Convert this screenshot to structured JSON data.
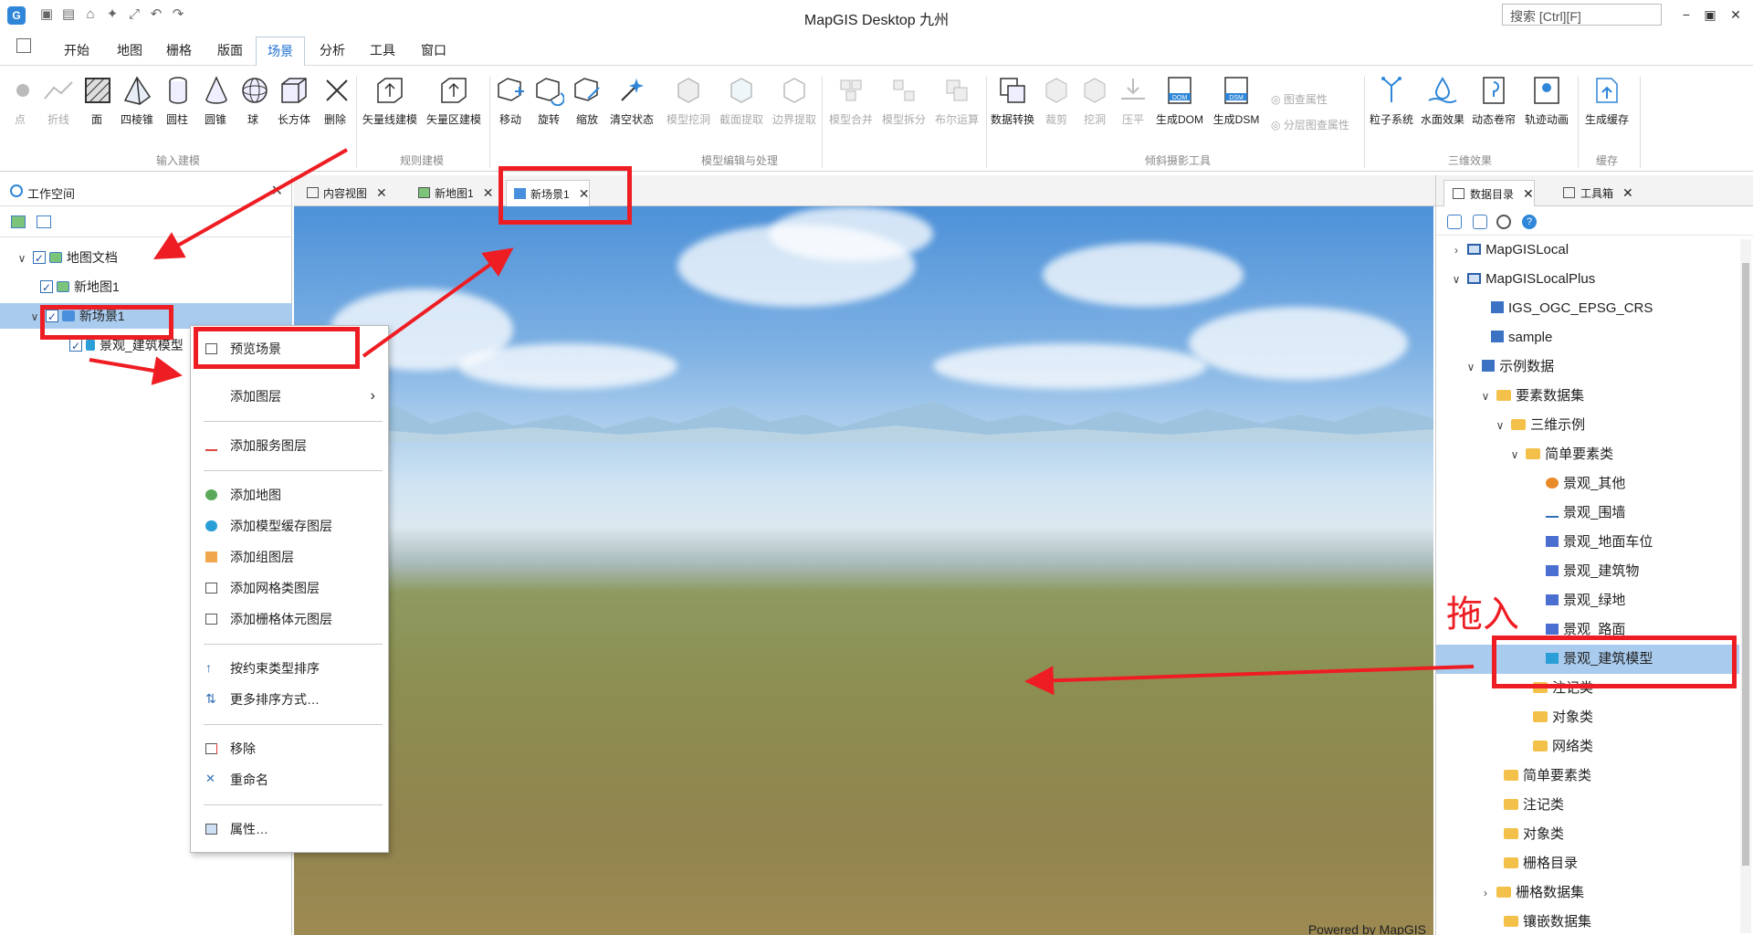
{
  "titlebar": {
    "title": "MapGIS Desktop 九州",
    "search_placeholder": "搜索 [Ctrl][F]"
  },
  "menu": {
    "tabs": [
      "开始",
      "地图",
      "栅格",
      "版面",
      "场景",
      "分析",
      "工具",
      "窗口"
    ],
    "active": "场景"
  },
  "ribbon": {
    "input_group": {
      "label": "输入建模",
      "buttons": [
        "点",
        "折线",
        "面",
        "四棱锥",
        "圆柱",
        "圆锥",
        "球",
        "长方体",
        "删除"
      ]
    },
    "rule_group": {
      "label": "规则建模",
      "buttons": [
        "矢量线建模",
        "矢量区建模"
      ]
    },
    "edit_group": {
      "label": "模型编辑与处理",
      "buttons": [
        "移动",
        "旋转",
        "缩放",
        "清空状态",
        "模型挖洞",
        "截面提取",
        "边界提取",
        "模型合并",
        "模型拆分",
        "布尔运算"
      ]
    },
    "oblique_group": {
      "label": "倾斜摄影工具",
      "buttons": [
        "数据转换",
        "裁剪",
        "挖洞",
        "压平",
        "生成DOM",
        "生成DSM"
      ],
      "small_buttons": [
        "图查属性",
        "分层图查属性"
      ]
    },
    "effects_group": {
      "label": "三维效果",
      "buttons": [
        "粒子系统",
        "水面效果",
        "动态卷帘",
        "轨迹动画"
      ]
    },
    "cache_group": {
      "label": "缓存",
      "buttons": [
        "生成缓存"
      ]
    }
  },
  "workspace": {
    "title": "工作空间",
    "tree": {
      "root": "地图文档",
      "map1": "新地图1",
      "scene1": "新场景1",
      "layer": "景观_建筑模型"
    }
  },
  "doc_tabs": [
    "内容视图",
    "新地图1",
    "新场景1"
  ],
  "scene": {
    "powered": "Powered by MapGIS"
  },
  "right_panel": {
    "tabs": [
      "数据目录",
      "工具箱"
    ],
    "tree": [
      "MapGISLocal",
      "MapGISLocalPlus",
      "IGS_OGC_EPSG_CRS",
      "sample",
      "示例数据",
      "要素数据集",
      "三维示例",
      "简单要素类",
      "景观_其他",
      "景观_围墙",
      "景观_地面车位",
      "景观_建筑物",
      "景观_绿地",
      "景观_路面",
      "景观_建筑模型",
      "注记类",
      "对象类",
      "网络类",
      "简单要素类",
      "注记类",
      "对象类",
      "栅格目录",
      "栅格数据集",
      "镶嵌数据集"
    ]
  },
  "context_menu": {
    "items": [
      "预览场景",
      "添加图层",
      "添加服务图层",
      "添加地图",
      "添加模型缓存图层",
      "添加组图层",
      "添加网格类图层",
      "添加栅格体元图层",
      "按约束类型排序",
      "更多排序方式…",
      "移除",
      "重命名",
      "属性…"
    ]
  },
  "annotations": {
    "drag_label": "拖入",
    "color": "#ee1d23"
  },
  "colors": {
    "accent": "#1c6fd0",
    "selection": "#a8cbee"
  }
}
